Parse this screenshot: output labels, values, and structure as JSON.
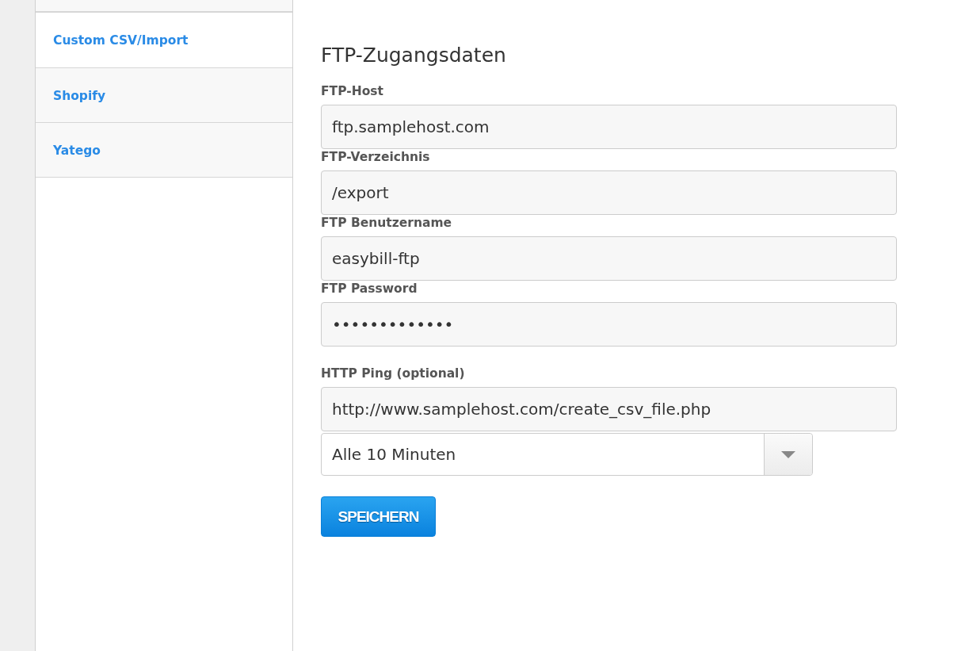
{
  "sidebar": {
    "items": [
      {
        "label": "Custom CSV/Import",
        "selected": true
      },
      {
        "label": "Shopify",
        "selected": false
      },
      {
        "label": "Yatego",
        "selected": false
      }
    ]
  },
  "form": {
    "title": "FTP-Zugangsdaten",
    "fields": [
      {
        "label": "FTP-Host",
        "value": "ftp.samplehost.com"
      },
      {
        "label": "FTP-Verzeichnis",
        "value": "/export"
      },
      {
        "label": "FTP Benutzername",
        "value": "easybill-ftp"
      },
      {
        "label": "FTP Password",
        "value": "•••••••••••••"
      },
      {
        "label": "HTTP Ping (optional)",
        "value": "http://www.samplehost.com/create_csv_file.php"
      }
    ],
    "interval": {
      "value": "Alle 10 Minuten"
    },
    "save_button": "SPEICHERN"
  }
}
